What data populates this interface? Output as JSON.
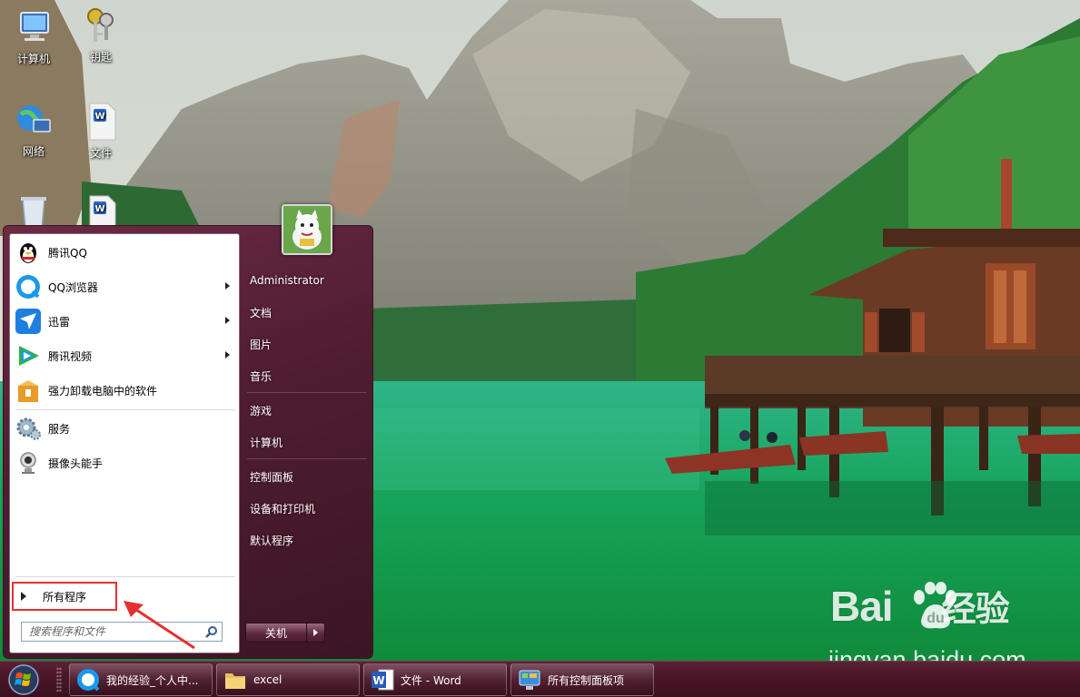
{
  "desktop": {
    "icons": [
      {
        "label": "计算机"
      },
      {
        "label": "钥匙"
      },
      {
        "label": "网络"
      },
      {
        "label": "文件"
      },
      {
        "label": ""
      },
      {
        "label": ""
      }
    ]
  },
  "start_menu": {
    "programs": [
      {
        "label": "腾讯QQ",
        "icon": "qq-penguin-icon"
      },
      {
        "label": "QQ浏览器",
        "icon": "qq-browser-icon"
      },
      {
        "label": "迅雷",
        "icon": "thunder-icon"
      },
      {
        "label": "腾讯视频",
        "icon": "tencent-video-icon"
      },
      {
        "label": "强力卸载电脑中的软件",
        "icon": "uninstall-box-icon"
      },
      {
        "label": "服务",
        "icon": "services-gear-icon"
      },
      {
        "label": "摄像头能手",
        "icon": "webcam-icon"
      }
    ],
    "all_programs_label": "所有程序",
    "search_placeholder": "搜索程序和文件",
    "right_items": [
      {
        "label": "Administrator"
      },
      {
        "label": "文档"
      },
      {
        "label": "图片"
      },
      {
        "label": "音乐"
      },
      {
        "label": "游戏"
      },
      {
        "label": "计算机"
      },
      {
        "label": "控制面板"
      },
      {
        "label": "设备和打印机"
      },
      {
        "label": "默认程序"
      }
    ],
    "shutdown_label": "关机"
  },
  "taskbar": {
    "buttons": [
      {
        "label": "我的经验_个人中...",
        "icon": "qq-browser-icon"
      },
      {
        "label": "excel",
        "icon": "folder-icon"
      },
      {
        "label": "文件 - Word",
        "icon": "word-icon"
      },
      {
        "label": "所有控制面板项",
        "icon": "control-panel-icon"
      }
    ]
  },
  "watermark": {
    "brand_left": "Bai",
    "brand_mid": "du",
    "brand_right": "经验",
    "url": "jingyan.baidu.com"
  },
  "colors": {
    "annotation": "#e53030",
    "menu_bg": "#4f1d32",
    "taskbar_bg": "#4a1628"
  }
}
